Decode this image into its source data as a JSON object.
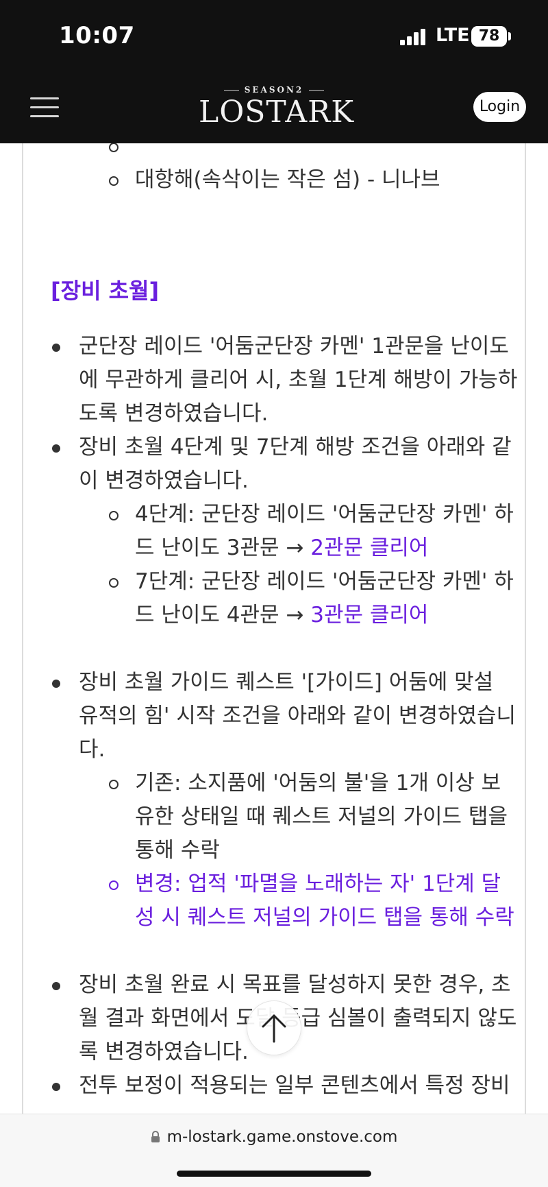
{
  "status_bar": {
    "time": "10:07",
    "network": "LTE",
    "battery": "78"
  },
  "header": {
    "logo_season": "SEASON2",
    "logo_text": "LOSTARK",
    "login_label": "Login"
  },
  "content": {
    "lead_items": [
      "대항해(속삭이는 작은 섬) - 니나브"
    ],
    "section_title": "[장비 초월]",
    "items": [
      {
        "text": "군단장 레이드 '어둠군단장 카멘' 1관문을 난이도에 무관하게 클리어 시, 초월 1단계 해방이 가능하도록 변경하였습니다."
      },
      {
        "text": "장비 초월 4단계 및 7단계 해방 조건을 아래와 같이 변경하였습니다.",
        "sub": [
          {
            "text": "4단계: 군단장 레이드 '어둠군단장 카멘' 하드 난이도 3관문 → ",
            "highlight": "2관문 클리어"
          },
          {
            "text": "7단계: 군단장 레이드 '어둠군단장 카멘' 하드 난이도 4관문 → ",
            "highlight": "3관문 클리어"
          }
        ]
      },
      {
        "text": "장비 초월 가이드 퀘스트 '[가이드] 어둠에 맞설 유적의 힘' 시작 조건을 아래와 같이 변경하였습니다.",
        "sub": [
          {
            "text": "기존: 소지품에 '어둠의 불'을 1개 이상 보유한 상태일 때 퀘스트 저널의 가이드 탭을 통해 수락"
          },
          {
            "text": "변경: 업적 '파멸을 노래하는 자' 1단계 달성 시 퀘스트 저널의 가이드 탭을 통해 수락"
          }
        ]
      },
      {
        "text": "장비 초월 완료 시 목표를 달성하지 못한 경우, 초월 결과 화면에서 도달 등급 심볼이 출력되지 않도록 변경하였습니다."
      },
      {
        "text": "전투 보정이 적용되는 일부 콘텐츠에서 특정 장비"
      }
    ]
  },
  "browser": {
    "url": "m-lostark.game.onstove.com"
  },
  "colors": {
    "accent_purple": "#6a1fde",
    "header_bg": "#111111",
    "body_text": "#333333"
  },
  "icons": {
    "menu": "hamburger-menu-icon",
    "scroll_top": "arrow-up-icon",
    "lock": "lock-icon"
  }
}
